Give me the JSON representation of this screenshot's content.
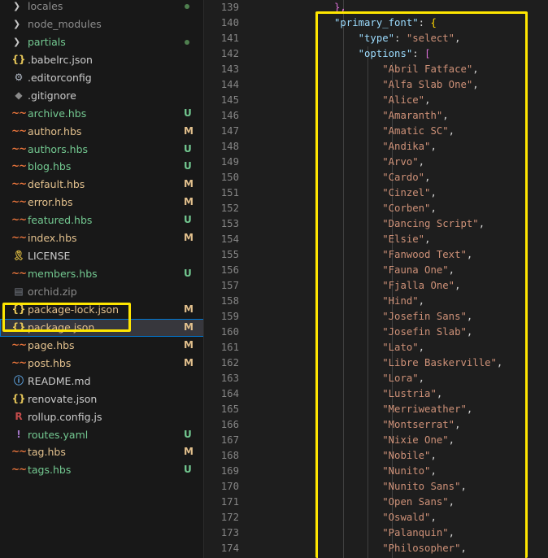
{
  "explorer": {
    "items": [
      {
        "type": "folder",
        "name": "locales",
        "status": "dot",
        "color": "c-ignored"
      },
      {
        "type": "folder",
        "name": "node_modules",
        "status": "",
        "color": "c-ignored"
      },
      {
        "type": "folder",
        "name": "partials",
        "status": "dot",
        "color": "c-untracked"
      },
      {
        "type": "file",
        "icon": "json",
        "glyph": "{}",
        "name": ".babelrc.json",
        "status": "",
        "color": "c-normal"
      },
      {
        "type": "file",
        "icon": "gear",
        "glyph": "⚙",
        "name": ".editorconfig",
        "status": "",
        "color": "c-normal"
      },
      {
        "type": "file",
        "icon": "git",
        "glyph": "◆",
        "name": ".gitignore",
        "status": "",
        "color": "c-normal"
      },
      {
        "type": "file",
        "icon": "hbs",
        "glyph": "~~",
        "name": "archive.hbs",
        "status": "U",
        "color": "c-untracked"
      },
      {
        "type": "file",
        "icon": "hbs",
        "glyph": "~~",
        "name": "author.hbs",
        "status": "M",
        "color": "c-modified"
      },
      {
        "type": "file",
        "icon": "hbs",
        "glyph": "~~",
        "name": "authors.hbs",
        "status": "U",
        "color": "c-untracked"
      },
      {
        "type": "file",
        "icon": "hbs",
        "glyph": "~~",
        "name": "blog.hbs",
        "status": "U",
        "color": "c-untracked"
      },
      {
        "type": "file",
        "icon": "hbs",
        "glyph": "~~",
        "name": "default.hbs",
        "status": "M",
        "color": "c-modified"
      },
      {
        "type": "file",
        "icon": "hbs",
        "glyph": "~~",
        "name": "error.hbs",
        "status": "M",
        "color": "c-modified"
      },
      {
        "type": "file",
        "icon": "hbs",
        "glyph": "~~",
        "name": "featured.hbs",
        "status": "U",
        "color": "c-untracked"
      },
      {
        "type": "file",
        "icon": "hbs",
        "glyph": "~~",
        "name": "index.hbs",
        "status": "M",
        "color": "c-modified"
      },
      {
        "type": "file",
        "icon": "lic",
        "glyph": "🎗",
        "name": "LICENSE",
        "status": "",
        "color": "c-normal"
      },
      {
        "type": "file",
        "icon": "hbs",
        "glyph": "~~",
        "name": "members.hbs",
        "status": "U",
        "color": "c-untracked"
      },
      {
        "type": "file",
        "icon": "zip",
        "glyph": "▤",
        "name": "orchid.zip",
        "status": "",
        "color": "c-ignored"
      },
      {
        "type": "file",
        "icon": "json",
        "glyph": "{}",
        "name": "package-lock.json",
        "status": "M",
        "color": "c-modified"
      },
      {
        "type": "file",
        "icon": "json",
        "glyph": "{}",
        "name": "package.json",
        "status": "M",
        "color": "c-modified",
        "selected": true
      },
      {
        "type": "file",
        "icon": "hbs",
        "glyph": "~~",
        "name": "page.hbs",
        "status": "M",
        "color": "c-modified"
      },
      {
        "type": "file",
        "icon": "hbs",
        "glyph": "~~",
        "name": "post.hbs",
        "status": "M",
        "color": "c-modified"
      },
      {
        "type": "file",
        "icon": "md",
        "glyph": "ⓘ",
        "name": "README.md",
        "status": "",
        "color": "c-normal"
      },
      {
        "type": "file",
        "icon": "json",
        "glyph": "{}",
        "name": "renovate.json",
        "status": "",
        "color": "c-normal"
      },
      {
        "type": "file",
        "icon": "js",
        "glyph": "R",
        "name": "rollup.config.js",
        "status": "",
        "color": "c-normal"
      },
      {
        "type": "file",
        "icon": "yaml",
        "glyph": "!",
        "name": "routes.yaml",
        "status": "U",
        "color": "c-untracked"
      },
      {
        "type": "file",
        "icon": "hbs",
        "glyph": "~~",
        "name": "tag.hbs",
        "status": "M",
        "color": "c-modified"
      },
      {
        "type": "file",
        "icon": "hbs",
        "glyph": "~~",
        "name": "tags.hbs",
        "status": "U",
        "color": "c-untracked"
      }
    ]
  },
  "editor": {
    "lines": [
      {
        "n": "139",
        "tokens": [
          {
            "t": "},",
            "c": "tk-brk2"
          }
        ]
      },
      {
        "n": "140",
        "tokens": [
          {
            "t": "\"primary_font\"",
            "c": "tk-key"
          },
          {
            "t": ": ",
            "c": "tk-pun"
          },
          {
            "t": "{",
            "c": "tk-brk1"
          }
        ]
      },
      {
        "n": "141",
        "tokens": [
          {
            "t": "    "
          },
          {
            "t": "\"type\"",
            "c": "tk-key"
          },
          {
            "t": ": ",
            "c": "tk-pun"
          },
          {
            "t": "\"select\"",
            "c": "tk-str"
          },
          {
            "t": ",",
            "c": "tk-pun"
          }
        ]
      },
      {
        "n": "142",
        "tokens": [
          {
            "t": "    "
          },
          {
            "t": "\"options\"",
            "c": "tk-key"
          },
          {
            "t": ": ",
            "c": "tk-pun"
          },
          {
            "t": "[",
            "c": "tk-brk2"
          }
        ]
      },
      {
        "n": "143",
        "tokens": [
          {
            "t": "        "
          },
          {
            "t": "\"Abril Fatface\"",
            "c": "tk-str"
          },
          {
            "t": ",",
            "c": "tk-pun"
          }
        ]
      },
      {
        "n": "144",
        "tokens": [
          {
            "t": "        "
          },
          {
            "t": "\"Alfa Slab One\"",
            "c": "tk-str"
          },
          {
            "t": ",",
            "c": "tk-pun"
          }
        ]
      },
      {
        "n": "145",
        "tokens": [
          {
            "t": "        "
          },
          {
            "t": "\"Alice\"",
            "c": "tk-str"
          },
          {
            "t": ",",
            "c": "tk-pun"
          }
        ]
      },
      {
        "n": "146",
        "tokens": [
          {
            "t": "        "
          },
          {
            "t": "\"Amaranth\"",
            "c": "tk-str"
          },
          {
            "t": ",",
            "c": "tk-pun"
          }
        ]
      },
      {
        "n": "147",
        "tokens": [
          {
            "t": "        "
          },
          {
            "t": "\"Amatic SC\"",
            "c": "tk-str"
          },
          {
            "t": ",",
            "c": "tk-pun"
          }
        ]
      },
      {
        "n": "148",
        "tokens": [
          {
            "t": "        "
          },
          {
            "t": "\"Andika\"",
            "c": "tk-str"
          },
          {
            "t": ",",
            "c": "tk-pun"
          }
        ]
      },
      {
        "n": "149",
        "tokens": [
          {
            "t": "        "
          },
          {
            "t": "\"Arvo\"",
            "c": "tk-str"
          },
          {
            "t": ",",
            "c": "tk-pun"
          }
        ]
      },
      {
        "n": "150",
        "tokens": [
          {
            "t": "        "
          },
          {
            "t": "\"Cardo\"",
            "c": "tk-str"
          },
          {
            "t": ",",
            "c": "tk-pun"
          }
        ]
      },
      {
        "n": "151",
        "tokens": [
          {
            "t": "        "
          },
          {
            "t": "\"Cinzel\"",
            "c": "tk-str"
          },
          {
            "t": ",",
            "c": "tk-pun"
          }
        ]
      },
      {
        "n": "152",
        "tokens": [
          {
            "t": "        "
          },
          {
            "t": "\"Corben\"",
            "c": "tk-str"
          },
          {
            "t": ",",
            "c": "tk-pun"
          }
        ]
      },
      {
        "n": "153",
        "tokens": [
          {
            "t": "        "
          },
          {
            "t": "\"Dancing Script\"",
            "c": "tk-str"
          },
          {
            "t": ",",
            "c": "tk-pun"
          }
        ]
      },
      {
        "n": "154",
        "tokens": [
          {
            "t": "        "
          },
          {
            "t": "\"Elsie\"",
            "c": "tk-str"
          },
          {
            "t": ",",
            "c": "tk-pun"
          }
        ]
      },
      {
        "n": "155",
        "tokens": [
          {
            "t": "        "
          },
          {
            "t": "\"Fanwood Text\"",
            "c": "tk-str"
          },
          {
            "t": ",",
            "c": "tk-pun"
          }
        ]
      },
      {
        "n": "156",
        "tokens": [
          {
            "t": "        "
          },
          {
            "t": "\"Fauna One\"",
            "c": "tk-str"
          },
          {
            "t": ",",
            "c": "tk-pun"
          }
        ]
      },
      {
        "n": "157",
        "tokens": [
          {
            "t": "        "
          },
          {
            "t": "\"Fjalla One\"",
            "c": "tk-str"
          },
          {
            "t": ",",
            "c": "tk-pun"
          }
        ]
      },
      {
        "n": "158",
        "tokens": [
          {
            "t": "        "
          },
          {
            "t": "\"Hind\"",
            "c": "tk-str"
          },
          {
            "t": ",",
            "c": "tk-pun"
          }
        ]
      },
      {
        "n": "159",
        "tokens": [
          {
            "t": "        "
          },
          {
            "t": "\"Josefin Sans\"",
            "c": "tk-str"
          },
          {
            "t": ",",
            "c": "tk-pun"
          }
        ]
      },
      {
        "n": "160",
        "tokens": [
          {
            "t": "        "
          },
          {
            "t": "\"Josefin Slab\"",
            "c": "tk-str"
          },
          {
            "t": ",",
            "c": "tk-pun"
          }
        ]
      },
      {
        "n": "161",
        "tokens": [
          {
            "t": "        "
          },
          {
            "t": "\"Lato\"",
            "c": "tk-str"
          },
          {
            "t": ",",
            "c": "tk-pun"
          }
        ]
      },
      {
        "n": "162",
        "tokens": [
          {
            "t": "        "
          },
          {
            "t": "\"Libre Baskerville\"",
            "c": "tk-str"
          },
          {
            "t": ",",
            "c": "tk-pun"
          }
        ]
      },
      {
        "n": "163",
        "tokens": [
          {
            "t": "        "
          },
          {
            "t": "\"Lora\"",
            "c": "tk-str"
          },
          {
            "t": ",",
            "c": "tk-pun"
          }
        ]
      },
      {
        "n": "164",
        "tokens": [
          {
            "t": "        "
          },
          {
            "t": "\"Lustria\"",
            "c": "tk-str"
          },
          {
            "t": ",",
            "c": "tk-pun"
          }
        ]
      },
      {
        "n": "165",
        "tokens": [
          {
            "t": "        "
          },
          {
            "t": "\"Merriweather\"",
            "c": "tk-str"
          },
          {
            "t": ",",
            "c": "tk-pun"
          }
        ]
      },
      {
        "n": "166",
        "tokens": [
          {
            "t": "        "
          },
          {
            "t": "\"Montserrat\"",
            "c": "tk-str"
          },
          {
            "t": ",",
            "c": "tk-pun"
          }
        ]
      },
      {
        "n": "167",
        "tokens": [
          {
            "t": "        "
          },
          {
            "t": "\"Nixie One\"",
            "c": "tk-str"
          },
          {
            "t": ",",
            "c": "tk-pun"
          }
        ]
      },
      {
        "n": "168",
        "tokens": [
          {
            "t": "        "
          },
          {
            "t": "\"Nobile\"",
            "c": "tk-str"
          },
          {
            "t": ",",
            "c": "tk-pun"
          }
        ]
      },
      {
        "n": "169",
        "tokens": [
          {
            "t": "        "
          },
          {
            "t": "\"Nunito\"",
            "c": "tk-str"
          },
          {
            "t": ",",
            "c": "tk-pun"
          }
        ]
      },
      {
        "n": "170",
        "tokens": [
          {
            "t": "        "
          },
          {
            "t": "\"Nunito Sans\"",
            "c": "tk-str"
          },
          {
            "t": ",",
            "c": "tk-pun"
          }
        ]
      },
      {
        "n": "171",
        "tokens": [
          {
            "t": "        "
          },
          {
            "t": "\"Open Sans\"",
            "c": "tk-str"
          },
          {
            "t": ",",
            "c": "tk-pun"
          }
        ]
      },
      {
        "n": "172",
        "tokens": [
          {
            "t": "        "
          },
          {
            "t": "\"Oswald\"",
            "c": "tk-str"
          },
          {
            "t": ",",
            "c": "tk-pun"
          }
        ]
      },
      {
        "n": "173",
        "tokens": [
          {
            "t": "        "
          },
          {
            "t": "\"Palanquin\"",
            "c": "tk-str"
          },
          {
            "t": ",",
            "c": "tk-pun"
          }
        ]
      },
      {
        "n": "174",
        "tokens": [
          {
            "t": "        "
          },
          {
            "t": "\"Philosopher\"",
            "c": "tk-str"
          },
          {
            "t": ",",
            "c": "tk-pun"
          }
        ]
      }
    ]
  }
}
